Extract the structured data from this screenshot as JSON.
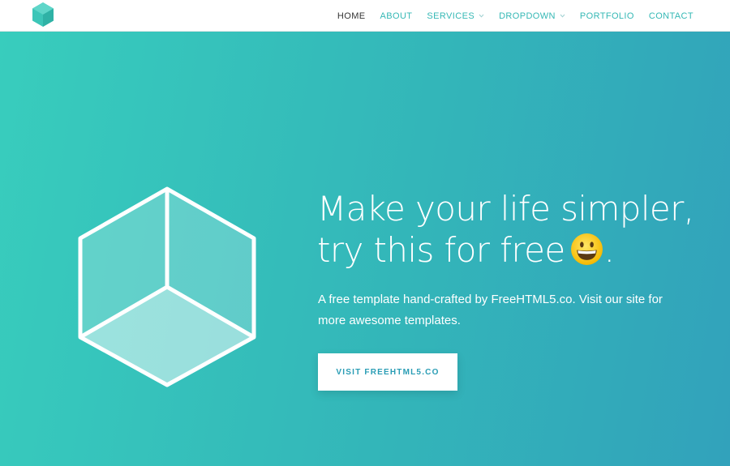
{
  "nav": {
    "logo": "hexagon-cube-logo",
    "items": [
      {
        "label": "HOME",
        "active": true,
        "has_dropdown": false
      },
      {
        "label": "ABOUT",
        "active": false,
        "has_dropdown": false
      },
      {
        "label": "SERVICES",
        "active": false,
        "has_dropdown": true
      },
      {
        "label": "DROPDOWN",
        "active": false,
        "has_dropdown": true
      },
      {
        "label": "PORTFOLIO",
        "active": false,
        "has_dropdown": false
      },
      {
        "label": "CONTACT",
        "active": false,
        "has_dropdown": false
      }
    ]
  },
  "hero": {
    "title_line1": "Make your life simpler,",
    "title_line2": "try this for free",
    "title_end": ".",
    "emoji": "grinning-face-emoji",
    "description": "A free template hand-crafted by FreeHTML5.co. Visit our site for more awesome templates.",
    "cta_label": "VISIT FREEHTML5.CO",
    "illustration": "cube-icon"
  },
  "colors": {
    "accent": "#35b8b5",
    "active_nav": "#333333",
    "gradient_start": "#38cdbd",
    "gradient_end": "#32a2bb",
    "cta_text": "#2a9db5"
  }
}
